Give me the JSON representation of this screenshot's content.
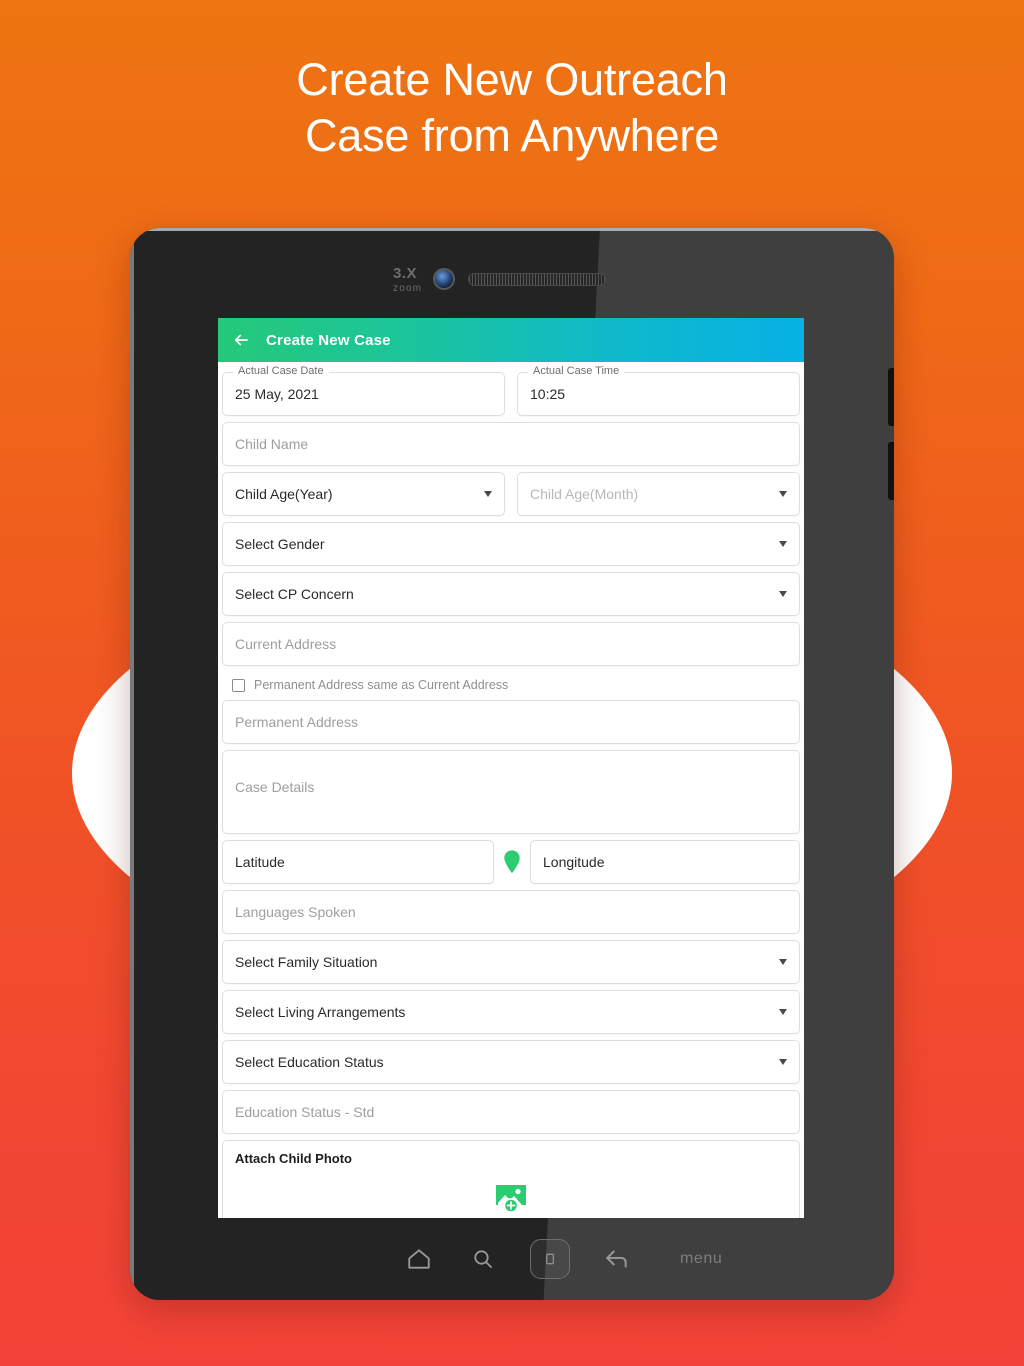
{
  "promo": {
    "headline": "Create New Outreach\nCase from Anywhere",
    "background_top_color": "#EE7512",
    "background_bottom_color": "#F34338"
  },
  "device": {
    "camera_zoom_label": "3.X",
    "camera_zoom_sub": "zoom"
  },
  "app": {
    "appbar": {
      "back_icon": "arrow-left-icon",
      "title": "Create New Case",
      "gradient_start": "#25C87A",
      "gradient_end": "#06B1E4"
    },
    "accent_color": "#2ECC71",
    "fields": {
      "actual_case_date": {
        "label": "Actual Case Date",
        "value": "25 May, 2021"
      },
      "actual_case_time": {
        "label": "Actual Case Time",
        "value": "10:25"
      },
      "child_name": {
        "placeholder": "Child Name"
      },
      "child_age_year": {
        "value": "Child Age(Year)"
      },
      "child_age_month": {
        "placeholder": "Child Age(Month)"
      },
      "select_gender": {
        "value": "Select Gender"
      },
      "select_cp_concern": {
        "value": "Select CP Concern"
      },
      "current_address": {
        "placeholder": "Current Address"
      },
      "permanent_same_checkbox": {
        "label": "Permanent Address same as Current Address",
        "checked": false
      },
      "permanent_address": {
        "placeholder": "Permanent Address"
      },
      "case_details": {
        "placeholder": "Case Details"
      },
      "latitude": {
        "value": "Latitude"
      },
      "longitude": {
        "value": "Longitude"
      },
      "languages_spoken": {
        "placeholder": "Languages Spoken"
      },
      "select_family_situation": {
        "value": "Select Family Situation"
      },
      "select_living_arrangements": {
        "value": "Select Living Arrangements"
      },
      "select_education_status": {
        "value": "Select Education Status"
      },
      "education_status_std": {
        "placeholder": "Education Status - Std"
      },
      "attach_child_photo": {
        "label": "Attach Child Photo",
        "icon": "add-photo-icon"
      }
    }
  },
  "navbar": {
    "home_icon": "home-icon",
    "search_icon": "search-icon",
    "recents_icon": "recents-icon",
    "back_icon": "back-arrow-icon",
    "menu_label": "menu"
  }
}
